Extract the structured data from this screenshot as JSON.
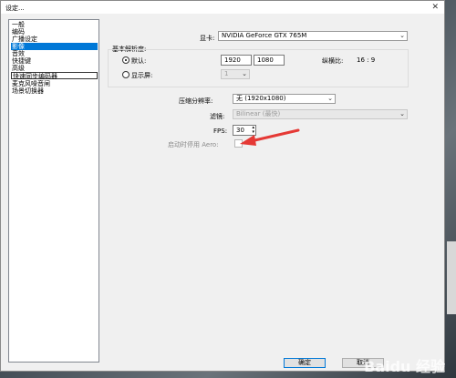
{
  "window": {
    "title": "设定...",
    "close_symbol": "✕"
  },
  "sidebar": {
    "items": [
      {
        "label": "一般"
      },
      {
        "label": "编码"
      },
      {
        "label": "广播设定"
      },
      {
        "label": "影像"
      },
      {
        "label": "音效"
      },
      {
        "label": "快捷键"
      },
      {
        "label": "高级"
      },
      {
        "label": "快速同步编码器"
      },
      {
        "label": "麦克风噪音闸"
      },
      {
        "label": "场景切换器"
      }
    ],
    "selected_index": 3
  },
  "video": {
    "gpu_label": "显卡:",
    "gpu_value": "NVIDIA GeForce GTX 765M",
    "base_res_label": "基本解析度:",
    "default_label": "默认:",
    "width": "1920",
    "height": "1080",
    "aspect_label": "纵横比:",
    "aspect_value": "16 : 9",
    "monitor_label": "显示屏:",
    "monitor_value": "1",
    "downscale_label": "压缩分辨率:",
    "downscale_value": "无 (1920x1080)",
    "filter_label": "滤镜:",
    "filter_value": "Bilinear (最快)",
    "fps_label": "FPS:",
    "fps_value": "30",
    "aero_label": "启动时停用 Aero:"
  },
  "buttons": {
    "ok": "确定",
    "cancel": "取消"
  },
  "watermark": {
    "text": "Baidu 经验"
  },
  "colors": {
    "selection": "#0078d7",
    "arrow": "#e53935"
  }
}
